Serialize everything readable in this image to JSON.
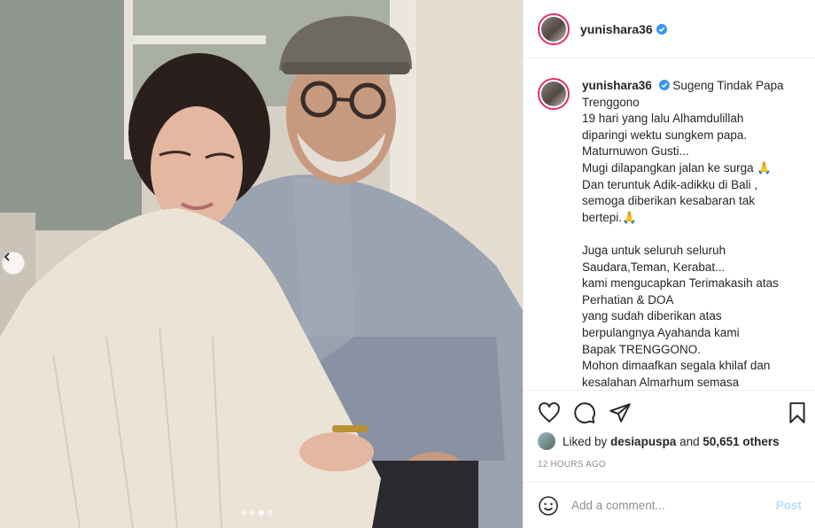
{
  "post": {
    "username": "yunishara36",
    "verified": true
  },
  "caption": {
    "lines": [
      "Sugeng Tindak Papa",
      "Trenggono",
      "19 hari yang lalu Alhamdulillah",
      "diparingi wektu sungkem papa.",
      "Maturnuwon Gusti...",
      "Mugi dilapangkan jalan ke surga 🙏",
      "Dan teruntuk Adik-adikku di Bali ,",
      "semoga diberikan kesabaran tak",
      "bertepi.🙏",
      "",
      "Juga untuk seluruh seluruh",
      "Saudara,Teman, Kerabat...",
      "kami mengucapkan Terimakasih atas",
      "Perhatian & DOA",
      "yang sudah diberikan atas",
      "berpulangnya Ayahanda kami",
      "Bapak TRENGGONO.",
      "Mohon dimaafkan segala khilaf dan",
      "kesalahan Almarhum semasa"
    ]
  },
  "engagement": {
    "liked_prefix": "Liked by ",
    "liked_user": "desiapuspa",
    "liked_mid": " and ",
    "liked_count": "50,651 others",
    "timestamp": "12 HOURS AGO"
  },
  "comment": {
    "placeholder": "Add a comment...",
    "post_label": "Post"
  },
  "icons": {
    "like": "heart-icon",
    "comment": "comment-icon",
    "share": "share-icon",
    "save": "bookmark-icon",
    "emoji": "emoji-icon",
    "verified": "verified-badge-icon",
    "prev": "chevron-left-icon"
  },
  "colors": {
    "verified_blue": "#3897f0",
    "story_ring": "#e1306c",
    "post_button_disabled": "#b2dffc",
    "muted_text": "#8e8e8e",
    "border": "#efefef"
  },
  "carousel": {
    "slide_count": 4,
    "active_slide": 3
  }
}
